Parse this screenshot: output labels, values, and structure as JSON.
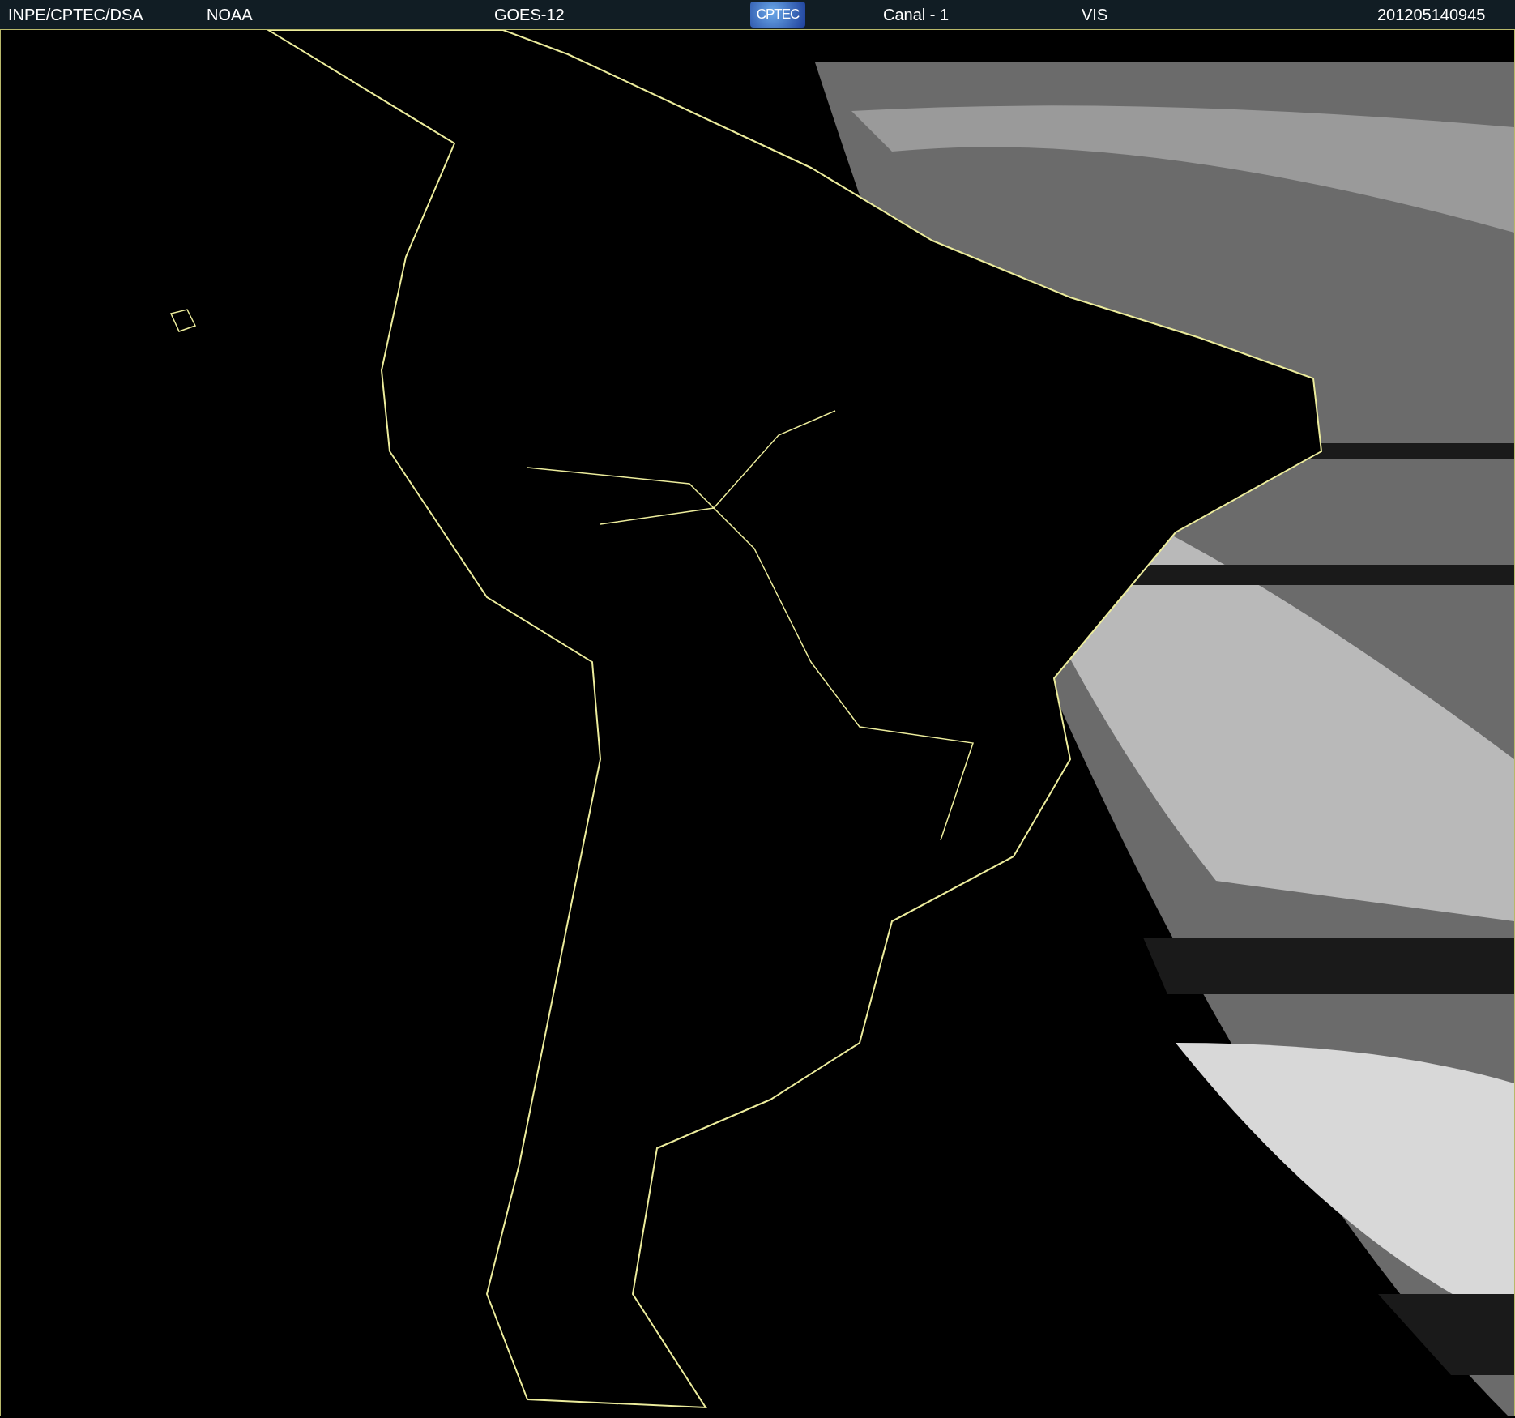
{
  "header": {
    "items": [
      {
        "kind": "text",
        "text": "INPE/CPTEC/DSA"
      },
      {
        "kind": "text",
        "text": "NOAA"
      },
      {
        "kind": "text",
        "text": "GOES-12"
      },
      {
        "kind": "logo",
        "text": "CPTEC"
      },
      {
        "kind": "text",
        "text": "Canal - 1"
      },
      {
        "kind": "text",
        "text": "VIS"
      },
      {
        "kind": "text",
        "text": "201205140945"
      }
    ]
  }
}
